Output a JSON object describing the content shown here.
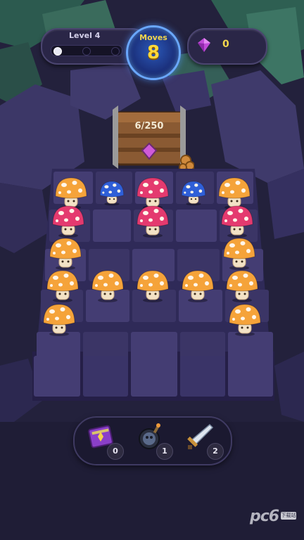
{
  "hud": {
    "level_label": "Level 4",
    "level_progress_steps": 3,
    "level_progress_current": 1,
    "moves_label": "Moves",
    "moves_value": "8",
    "gems_value": "0"
  },
  "chest": {
    "progress_text": "6/250"
  },
  "board": {
    "rows": 5,
    "cols": 5,
    "grid": [
      [
        "orange",
        "blue_pink_pair_left",
        "pink",
        "blue",
        "orange"
      ],
      [
        "pink",
        "empty",
        "pink",
        "empty",
        "pink"
      ],
      [
        "orange",
        "empty",
        "empty",
        "empty",
        "orange"
      ],
      [
        "orange",
        "orange",
        "orange",
        "orange",
        "orange"
      ],
      [
        "orange",
        "empty",
        "empty",
        "empty",
        "orange"
      ]
    ]
  },
  "powerups": [
    {
      "name": "spellbook",
      "count": "0"
    },
    {
      "name": "bomb",
      "count": "1"
    },
    {
      "name": "sword",
      "count": "2"
    }
  ],
  "watermark": {
    "text": "pc6",
    "sub": "下载站"
  },
  "colors": {
    "orange": "#f5a33a",
    "pink": "#e43a6f",
    "blue": "#2f5fd8",
    "tile": "#3b3566",
    "background": "#22203b"
  }
}
